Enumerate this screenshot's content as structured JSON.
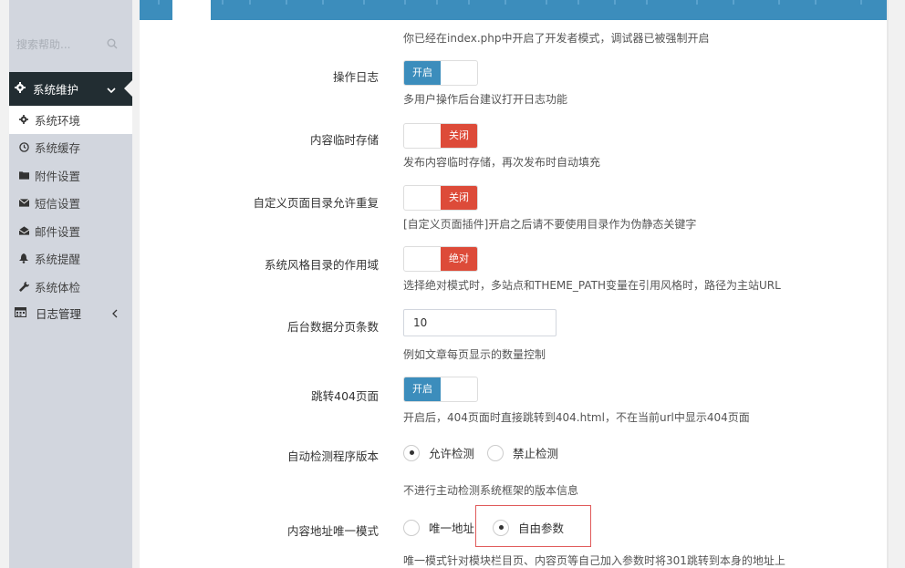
{
  "sidebar": {
    "search_placeholder": "搜索帮助...",
    "active_menu": "系统维护",
    "sub_items": [
      {
        "label": "系统环境",
        "icon": "gear-icon"
      },
      {
        "label": "系统缓存",
        "icon": "clock-icon"
      },
      {
        "label": "附件设置",
        "icon": "folder-icon"
      },
      {
        "label": "短信设置",
        "icon": "envelope-icon"
      },
      {
        "label": "邮件设置",
        "icon": "envelope-open-icon"
      },
      {
        "label": "系统提醒",
        "icon": "bell-icon"
      },
      {
        "label": "系统体检",
        "icon": "wrench-icon"
      }
    ],
    "log_menu": "日志管理"
  },
  "settings": {
    "debug_help": "你已经在index.php中开启了开发者模式，调试器已被强制开启",
    "oplog": {
      "label": "操作日志",
      "switch": "开启",
      "state": "on",
      "help": "多用户操作后台建议打开日志功能"
    },
    "temp_storage": {
      "label": "内容临时存储",
      "switch": "关闭",
      "state": "off",
      "help": "发布内容临时存储，再次发布时自动填充"
    },
    "page_dir_repeat": {
      "label": "自定义页面目录允许重复",
      "switch": "关闭",
      "state": "off",
      "help": "[自定义页面插件]开启之后请不要使用目录作为伪静态关键字"
    },
    "theme_scope": {
      "label": "系统风格目录的作用域",
      "switch": "绝对",
      "state": "off",
      "help": "选择绝对模式时，多站点和THEME_PATH变量在引用风格时，路径为主站URL"
    },
    "pagesize": {
      "label": "后台数据分页条数",
      "value": "10",
      "help": "例如文章每页显示的数量控制"
    },
    "redirect404": {
      "label": "跳转404页面",
      "switch": "开启",
      "state": "on",
      "help": "开启后，404页面时直接跳转到404.html，不在当前url中显示404页面"
    },
    "version_check": {
      "label": "自动检测程序版本",
      "options": [
        "允许检测",
        "禁止检测"
      ],
      "selected": "允许检测",
      "help": "不进行主动检测系统框架的版本信息"
    },
    "unique_url": {
      "label": "内容地址唯一模式",
      "options": [
        "唯一地址",
        "自由参数"
      ],
      "selected": "自由参数",
      "help": "唯一模式针对模块栏目页、内容页等自己加入参数时将301跳转到本身的地址上"
    }
  },
  "colors": {
    "primary": "#3c8dbc",
    "danger": "#dd4b39",
    "sidebar_dark": "#222d32",
    "sidebar": "#d2d6de",
    "highlight": "#e05a5a"
  }
}
